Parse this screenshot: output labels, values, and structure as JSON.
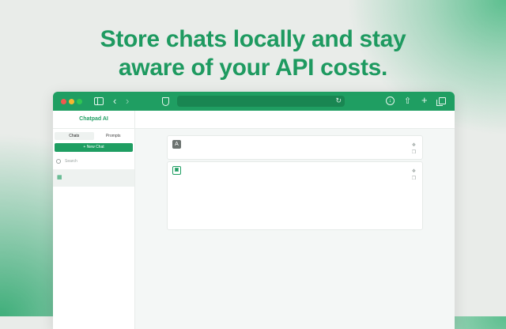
{
  "headline": {
    "line1": "Store chats locally and stay",
    "line2": "aware of your API costs."
  },
  "browser": {
    "icons": [
      "sidebar-icon",
      "back-icon",
      "forward-icon",
      "shield-icon",
      "reload-icon",
      "download-icon",
      "share-icon",
      "plus-icon",
      "tabs-icon"
    ],
    "accent": "#1f9e62"
  },
  "sidebar": {
    "brand": "Chatpad AI",
    "tabs": [
      {
        "label": "Chats",
        "active": true
      },
      {
        "label": "Prompts",
        "active": false
      }
    ],
    "new_chat": "New Chat",
    "search_placeholder": "Search"
  },
  "messages": [
    {
      "role": "user",
      "avatar": "A"
    },
    {
      "role": "assistant",
      "avatar": "logo"
    }
  ]
}
